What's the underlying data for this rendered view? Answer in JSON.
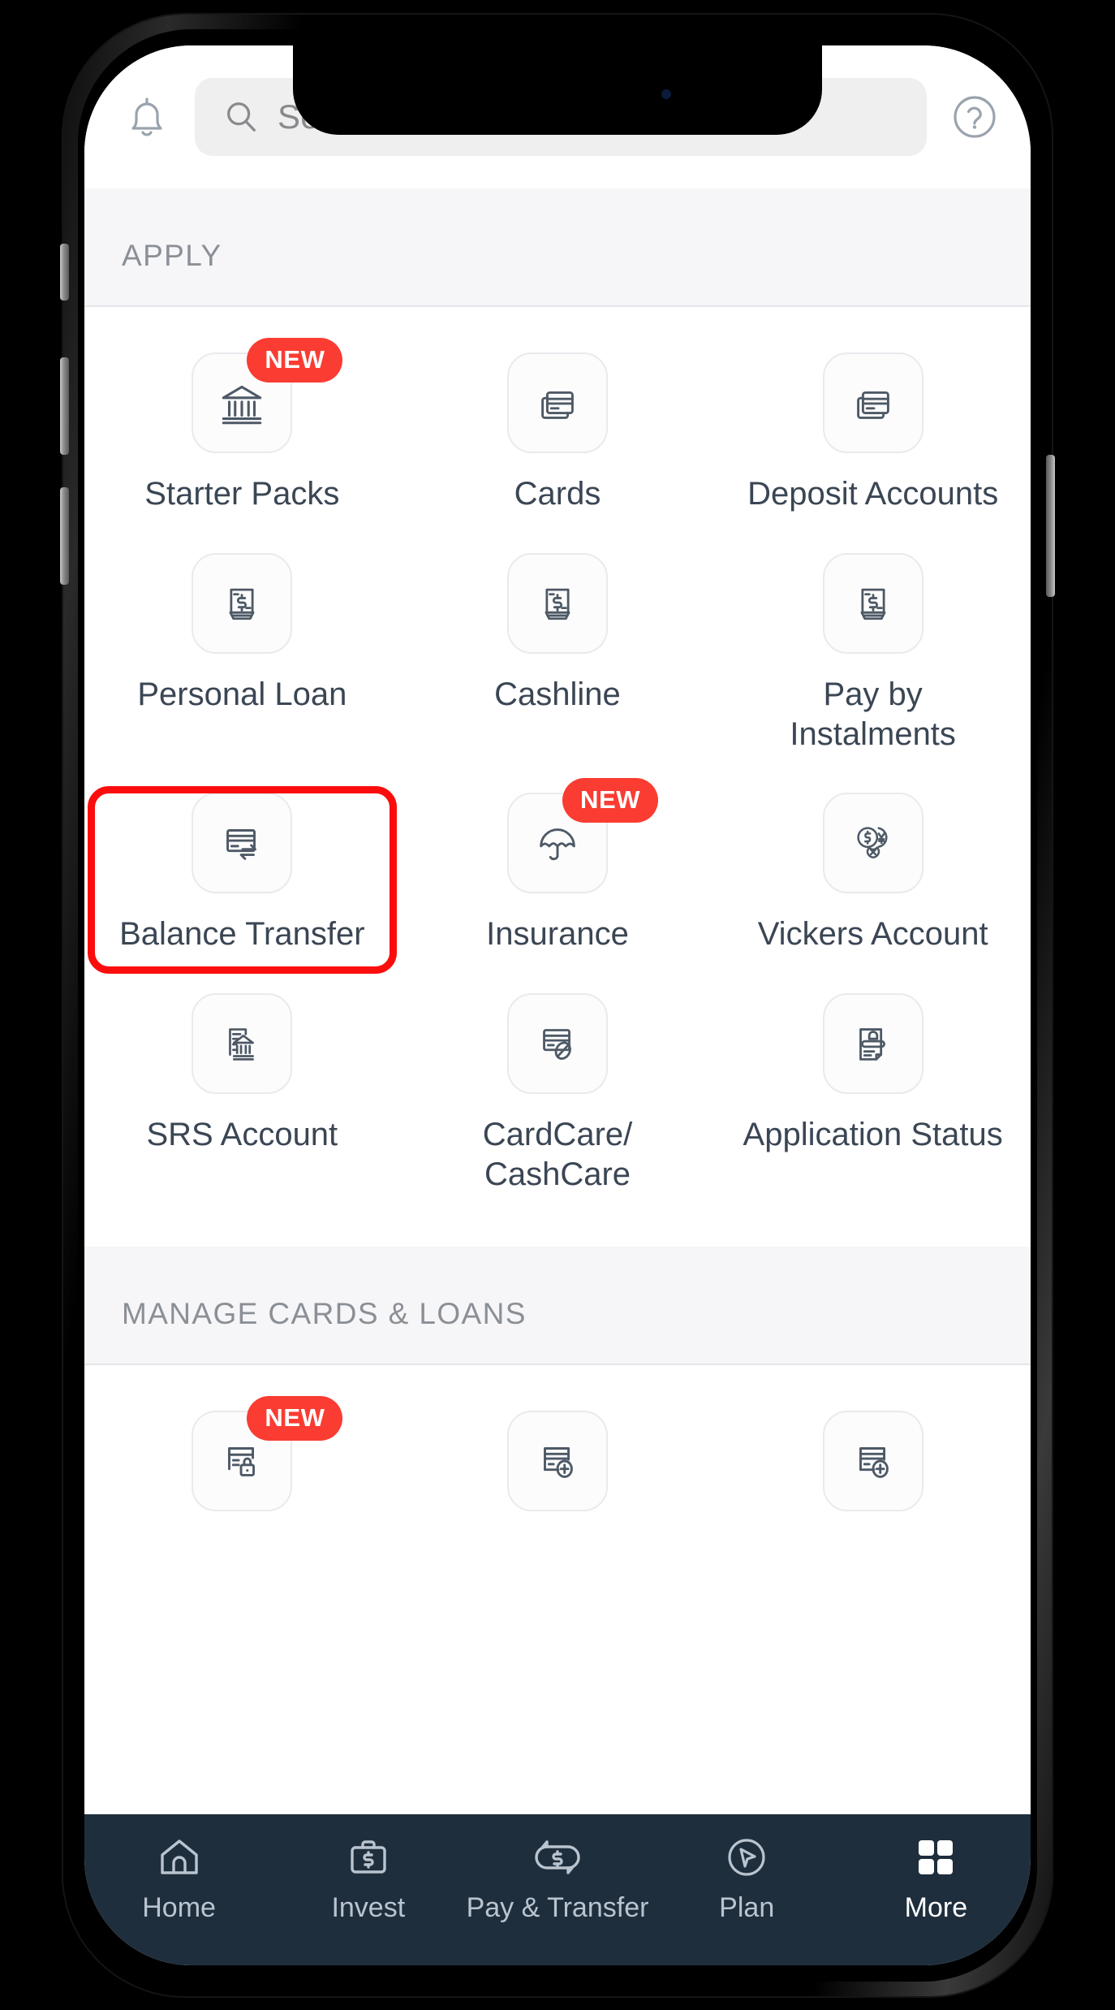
{
  "header": {
    "notification_icon": "bell-icon",
    "help_icon": "help-circle-icon",
    "search": {
      "icon": "search-icon",
      "placeholder": "Search",
      "value": ""
    }
  },
  "sections": [
    {
      "title": "APPLY",
      "items": [
        {
          "label": "Starter Packs",
          "icon": "bank-building-icon",
          "badge": "NEW",
          "highlighted": false
        },
        {
          "label": "Cards",
          "icon": "stacked-cards-icon",
          "badge": "",
          "highlighted": false
        },
        {
          "label": "Deposit Accounts",
          "icon": "stacked-cards-icon",
          "badge": "",
          "highlighted": false
        },
        {
          "label": "Personal Loan",
          "icon": "banknote-stack-icon",
          "badge": "",
          "highlighted": false
        },
        {
          "label": "Cashline",
          "icon": "banknote-stack-icon",
          "badge": "",
          "highlighted": false
        },
        {
          "label": "Pay by Instalments",
          "icon": "banknote-stack-icon",
          "badge": "",
          "highlighted": false
        },
        {
          "label": "Balance Transfer",
          "icon": "card-transfer-icon",
          "badge": "",
          "highlighted": true
        },
        {
          "label": "Insurance",
          "icon": "umbrella-icon",
          "badge": "NEW",
          "highlighted": false
        },
        {
          "label": "Vickers Account",
          "icon": "currency-exchange-icon",
          "badge": "",
          "highlighted": false
        },
        {
          "label": "SRS Account",
          "icon": "document-bank-icon",
          "badge": "",
          "highlighted": false
        },
        {
          "label": "CardCare/\nCashCare",
          "icon": "card-protect-icon",
          "badge": "",
          "highlighted": false
        },
        {
          "label": "Application Status",
          "icon": "document-status-icon",
          "badge": "",
          "highlighted": false
        }
      ]
    },
    {
      "title": "MANAGE CARDS & LOANS",
      "items": [
        {
          "label": "",
          "icon": "card-lock-icon",
          "badge": "NEW",
          "highlighted": false
        },
        {
          "label": "",
          "icon": "card-plus-icon",
          "badge": "",
          "highlighted": false
        },
        {
          "label": "",
          "icon": "card-plus-icon",
          "badge": "",
          "highlighted": false
        }
      ]
    }
  ],
  "bottom_nav": {
    "items": [
      {
        "label": "Home",
        "icon": "home-icon",
        "active": false
      },
      {
        "label": "Invest",
        "icon": "briefcase-dollar-icon",
        "active": false
      },
      {
        "label": "Pay & Transfer",
        "icon": "transfer-dollar-icon",
        "active": false
      },
      {
        "label": "Plan",
        "icon": "compass-cursor-icon",
        "active": false
      },
      {
        "label": "More",
        "icon": "grid-four-icon",
        "active": true
      }
    ]
  },
  "colors": {
    "badge_red": "#fa3c32",
    "highlight_red": "#fc0d0d",
    "nav_background": "#1f2e3d",
    "nav_active_text": "#ffffff",
    "nav_inactive_text": "#b9c4cf",
    "section_header_text": "#8b8f96",
    "section_header_bg": "#f6f6f8",
    "tile_label_text": "#3b4654",
    "search_bg": "#efeff0"
  }
}
